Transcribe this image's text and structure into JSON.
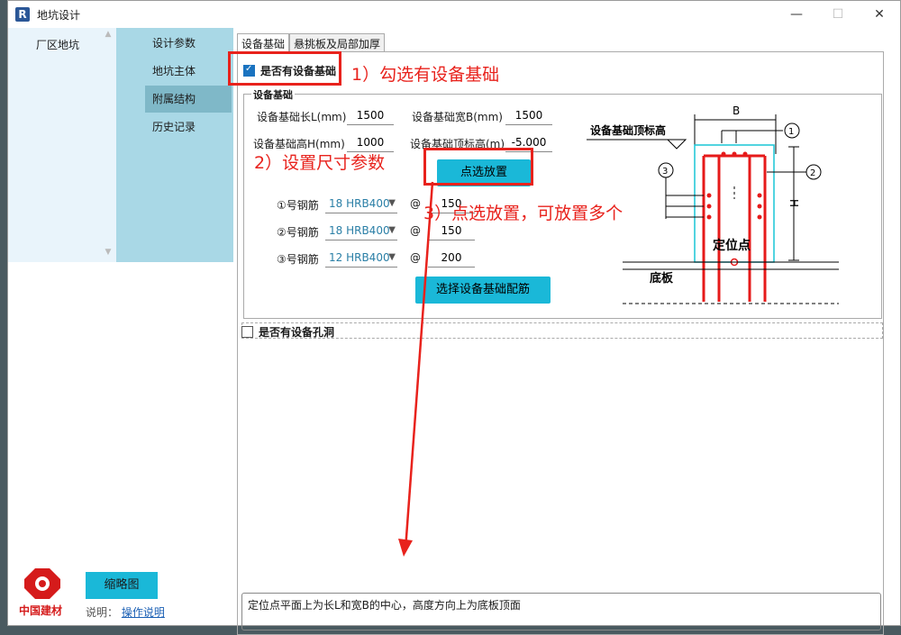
{
  "window": {
    "app_icon": "R",
    "title": "地坑设计",
    "minimize": "—",
    "maximize": "☐",
    "close": "✕"
  },
  "nav_primary": {
    "items": [
      {
        "label": "厂区地坑"
      }
    ]
  },
  "nav_secondary": {
    "items": [
      {
        "label": "设计参数"
      },
      {
        "label": "地坑主体"
      },
      {
        "label": "附属结构",
        "active": true
      },
      {
        "label": "历史记录"
      }
    ]
  },
  "tabs": [
    {
      "label": "设备基础",
      "active": true
    },
    {
      "label": "悬挑板及局部加厚"
    }
  ],
  "equipment": {
    "checkbox_label": "是否有设备基础",
    "checked": true,
    "group_title": "设备基础",
    "length_label": "设备基础长L(mm)",
    "length_value": "1500",
    "width_label": "设备基础宽B(mm)",
    "width_value": "1500",
    "height_label": "设备基础高H(mm)",
    "height_value": "1000",
    "top_elev_label": "设备基础顶标高(m)",
    "top_elev_value": "-5.000",
    "place_button": "点选放置",
    "rebars": [
      {
        "label": "①号钢筋",
        "type": "18 HRB400",
        "at": "@",
        "spacing": "150"
      },
      {
        "label": "②号钢筋",
        "type": "18 HRB400",
        "at": "@",
        "spacing": "150"
      },
      {
        "label": "③号钢筋",
        "type": "12 HRB400",
        "at": "@",
        "spacing": "200"
      }
    ],
    "select_rebar_button": "选择设备基础配筋"
  },
  "diagram": {
    "dim_b": "B",
    "dim_h": "H",
    "top_label": "设备基础顶标高",
    "mark_1": "1",
    "mark_2": "2",
    "mark_3": "3",
    "locate": "定位点",
    "base": "底板"
  },
  "hole": {
    "checkbox_label": "是否有设备孔洞",
    "checked": false
  },
  "note_text": "定位点平面上为长L和宽B的中心，高度方向上为底板顶面",
  "annotations": {
    "step1": "1）勾选有设备基础",
    "step2": "2）设置尺寸参数",
    "step3": "3）点选放置，可放置多个"
  },
  "footer": {
    "logo_text": "中国建材",
    "thumbnail_button": "缩略图",
    "explain_label": "说明：",
    "explain_link": "操作说明"
  },
  "colors": {
    "accent_button": "#1ab8d8",
    "annotation_red": "#e8221c",
    "nav_secondary_bg": "#a9d8e6"
  }
}
